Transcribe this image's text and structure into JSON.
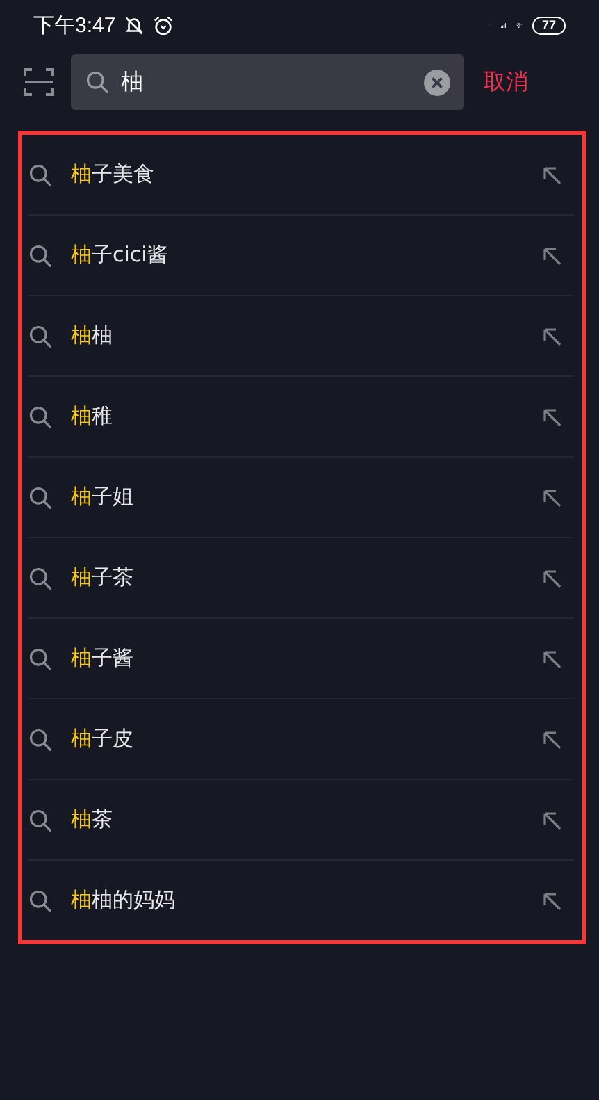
{
  "status_bar": {
    "time": "下午3:47",
    "battery": "77"
  },
  "search": {
    "value": "柚",
    "cancel": "取消"
  },
  "suggestions": [
    {
      "match": "柚",
      "rest": "子美食"
    },
    {
      "match": "柚",
      "rest": "子cici酱"
    },
    {
      "match": "柚",
      "rest": "柚"
    },
    {
      "match": "柚",
      "rest": "稚"
    },
    {
      "match": "柚",
      "rest": "子姐"
    },
    {
      "match": "柚",
      "rest": "子茶"
    },
    {
      "match": "柚",
      "rest": "子酱"
    },
    {
      "match": "柚",
      "rest": "子皮"
    },
    {
      "match": "柚",
      "rest": "茶"
    },
    {
      "match": "柚",
      "rest": "柚的妈妈"
    }
  ]
}
